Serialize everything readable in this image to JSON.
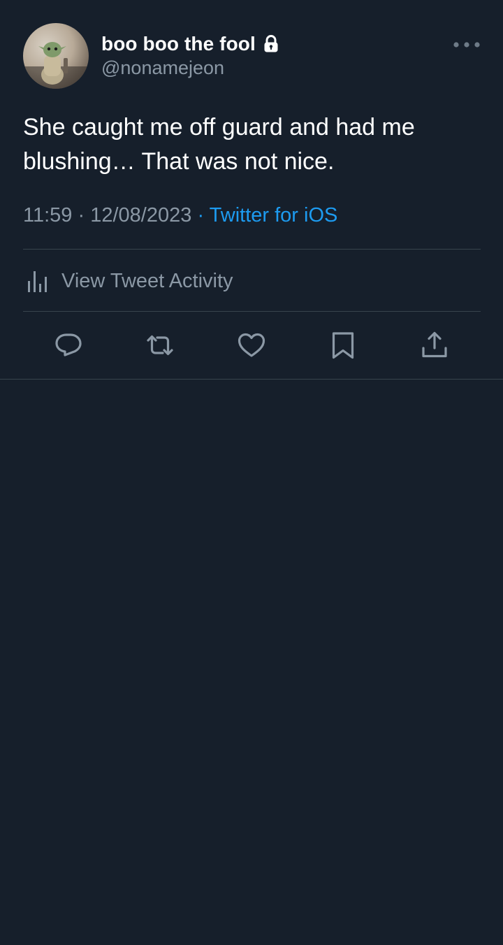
{
  "tweet": {
    "author": {
      "display_name": "boo boo the fool",
      "handle": "@nonamejeon",
      "avatar_icon": "avatar-figurine",
      "protected_icon": "lock-icon"
    },
    "text": "She caught me off guard and had me blushing… That was not nice.",
    "time": "11:59",
    "separator": "·",
    "date": "12/08/2023",
    "source": "Twitter for iOS",
    "activity_label": "View Tweet Activity",
    "actions": [
      "reply-icon",
      "retweet-icon",
      "like-icon",
      "bookmark-icon",
      "share-icon"
    ]
  },
  "colors": {
    "background": "#161f2b",
    "primary_text": "#ffffff",
    "secondary_text": "#8b98a5",
    "accent": "#1d9bf0",
    "divider": "#38444d"
  }
}
